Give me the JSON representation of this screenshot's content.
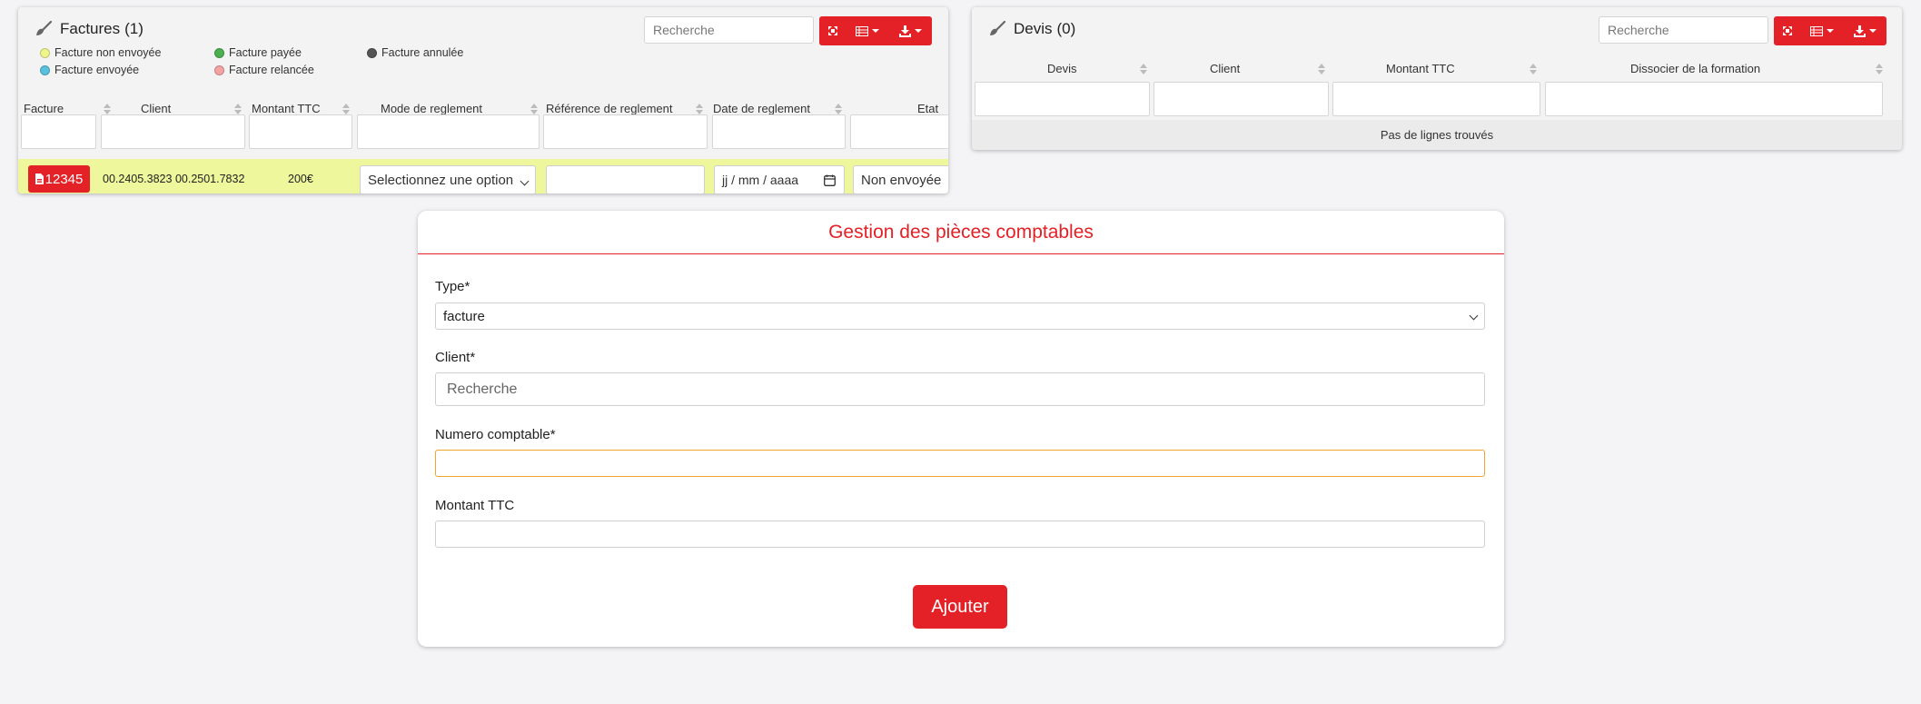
{
  "factures": {
    "title": "Factures",
    "count": "(1)",
    "search_placeholder": "Recherche",
    "legend": [
      {
        "label": "Facture non envoyée",
        "color": "#eef58a"
      },
      {
        "label": "Facture envoyée",
        "color": "#5bc0de"
      },
      {
        "label": "Facture payée",
        "color": "#4caf50"
      },
      {
        "label": "Facture relancée",
        "color": "#f4a3a3"
      },
      {
        "label": "Facture annulée",
        "color": "#555555"
      }
    ],
    "columns": [
      "Facture",
      "Client",
      "Montant TTC",
      "Mode de reglement",
      "Référence de reglement",
      "Date de reglement",
      "Etat"
    ],
    "row": {
      "invoice_number": "12345",
      "client": "00.2405.3823 00.2501.7832",
      "montant": "200€",
      "mode_select": "Selectionnez une option",
      "reference": "",
      "date_placeholder": "jj / mm / aaaa",
      "etat": "Non envoyée"
    }
  },
  "devis": {
    "title": "Devis",
    "count": "(0)",
    "search_placeholder": "Recherche",
    "columns": [
      "Devis",
      "Client",
      "Montant TTC",
      "Dissocier de la formation"
    ],
    "empty_message": "Pas de lignes trouvés"
  },
  "form": {
    "title": "Gestion des pièces comptables",
    "type_label": "Type*",
    "type_value": "facture",
    "client_label": "Client*",
    "client_placeholder": "Recherche",
    "numero_label": "Numero comptable*",
    "numero_value": "",
    "montant_label": "Montant TTC",
    "montant_value": "",
    "submit_label": "Ajouter"
  },
  "colors": {
    "accent": "#e42127",
    "row_highlight": "#eef79b",
    "focus": "#efa52e"
  }
}
